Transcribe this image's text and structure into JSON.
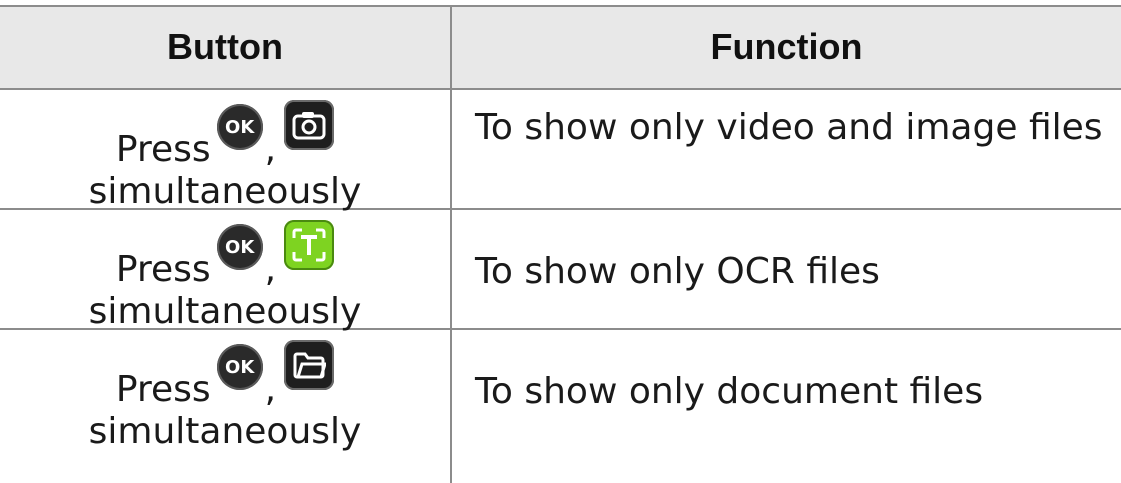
{
  "header": {
    "button_label": "Button",
    "function_label": "Function"
  },
  "rows": [
    {
      "press": "Press",
      "ok_label": "OK",
      "comma": ",",
      "second_icon": "camera-icon",
      "line2": "simultaneously",
      "function": "To show only video and image files"
    },
    {
      "press": "Press",
      "ok_label": "OK",
      "comma": ",",
      "second_icon": "ocr-text-icon",
      "line2": "simultaneously",
      "function": "To show only OCR files"
    },
    {
      "press": "Press",
      "ok_label": "OK",
      "comma": ",",
      "second_icon": "folder-icon",
      "line2": "simultaneously",
      "function": "To show only document files"
    }
  ],
  "colors": {
    "header_bg": "#e8e8e8",
    "ocr_icon_bg": "#7ed321",
    "dark_icon_bg": "#1e1e1e",
    "border": "#8c8c8c"
  }
}
